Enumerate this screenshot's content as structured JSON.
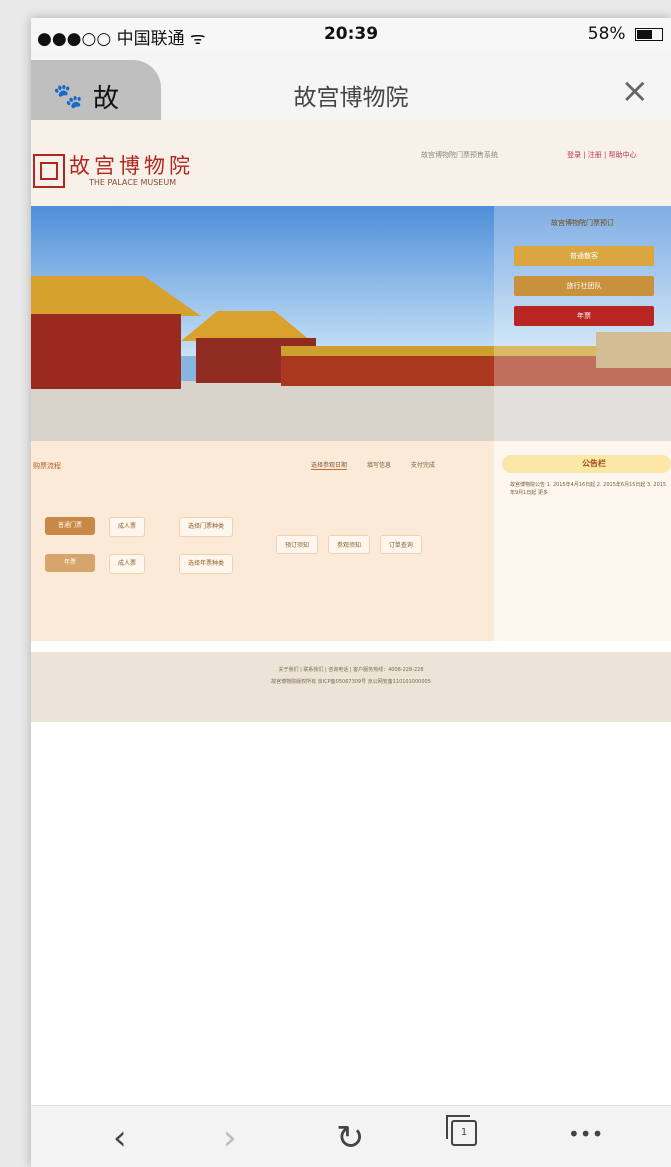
{
  "status_bar": {
    "carrier": "●●●○○ 中国联通 ᯤ",
    "time": "20:39",
    "battery": "58%"
  },
  "browser": {
    "tab_label": "故",
    "page_title": "故宫博物院"
  },
  "site": {
    "logo": {
      "name_cn": "故宫博物院",
      "name_en": "THE PALACE MUSEUM"
    },
    "header_link": "故宫博物院门票预售系统",
    "header_nav": "登录 | 注册 | 帮助中心"
  },
  "banner": {
    "overlay_title": "故宫博物院门票预订",
    "buttons": [
      "普通散客",
      "旅行社团队",
      "年票"
    ]
  },
  "tickets": {
    "section_title": "购票流程",
    "tabs": [
      "选择参观日期",
      "填写信息",
      "支付完成"
    ],
    "rows": [
      {
        "type": "普通门票",
        "options": [
          "成人票",
          "选择门票种类"
        ]
      },
      {
        "type": "年票",
        "options": [
          "成人票",
          "选择年票种类"
        ]
      }
    ],
    "actions": [
      "预订须知",
      "参观须知",
      "订单查询"
    ]
  },
  "notice": {
    "title": "公告栏",
    "text": "故宫博物院公告 1. 2015年4月16日起 2. 2015年6月15日起 3. 2015年9月1日起 更多"
  },
  "footer": {
    "line1": "关于我们 | 联系我们 | 咨询电话 | 客户服务热线：4008-228-228",
    "line2": "故宫博物院版权所有 京ICP备05067309号 京公网安备110101000005"
  }
}
